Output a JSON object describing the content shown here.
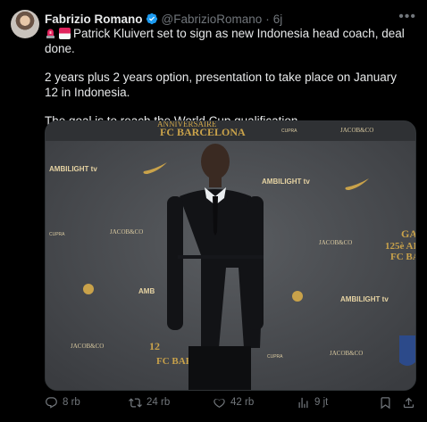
{
  "tweet": {
    "author_name": "Fabrizio Romano",
    "handle": "@FabrizioRomano",
    "separator": "·",
    "time": "6j",
    "headline": "Patrick Kluivert set to sign as new Indonesia head coach, deal done.",
    "paragraph2": "2 years plus 2 years option, presentation to take place on January 12 in Indonesia.",
    "paragraph3": "The goal is to reach the World Cup qualification."
  },
  "media": {
    "backdrop_texts": {
      "top_banner_line1": "ANNIVERSAIRE",
      "fc_barcelona_top": "FC BARCELONA",
      "ambilight_1": "AMBILIGHT tv",
      "ambilight_2": "AMBILIGHT tv",
      "ambilight_3": "AMBILIGHT tv",
      "ambilight_4": "AMB",
      "jacob_1": "JACOB&CO",
      "jacob_2": "JACOB&CO",
      "jacob_3": "JACOB&CO",
      "jacob_4": "JACOB&CO",
      "jacob_5": "JACOB&CO",
      "cupra_1": "CUPRA",
      "cupra_2": "CUPRA",
      "cupra_3": "CUPRA",
      "right_125": "GA",
      "right_125b": "125è AI",
      "right_fc": "FC BA",
      "bottom_125": "12",
      "bottom_fc": "FC BARCELONA"
    }
  },
  "actions": {
    "replies": "8 rb",
    "reposts": "24 rb",
    "likes": "42 rb",
    "views": "9 jt"
  },
  "colors": {
    "background": "#000000",
    "text": "#e7e9ea",
    "muted": "#71767b",
    "verified": "#1d9bf0",
    "gold": "#c9a24a"
  }
}
